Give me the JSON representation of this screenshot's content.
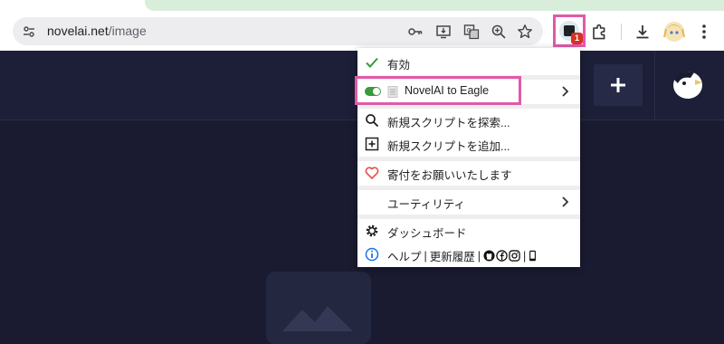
{
  "browser": {
    "url_host": "novelai.net",
    "url_path": "/image",
    "extension_badge": "1"
  },
  "menu": {
    "enabled_label": "有効",
    "script_name": "NovelAI to Eagle",
    "find_scripts_label": "新規スクリプトを探索...",
    "add_script_label": "新規スクリプトを追加...",
    "donate_label": "寄付をお願いいたします",
    "utilities_label": "ユーティリティ",
    "dashboard_label": "ダッシュボード",
    "help_label": "ヘルプ",
    "separator": "|",
    "changelog_label": "更新履歴"
  },
  "colors": {
    "highlight": "#e05aa8",
    "page_bg": "#1a1b31",
    "toggle_on": "#3a9a3a",
    "heart": "#e8534a"
  },
  "icons": [
    "site-info-icon",
    "key-icon",
    "install-app-icon",
    "translate-icon",
    "zoom-icon",
    "star-icon",
    "tampermonkey-icon",
    "puzzle-icon",
    "download-icon",
    "profile-avatar-icon",
    "kebab-menu-icon",
    "plus-icon",
    "novelai-logo",
    "check-icon",
    "script-file-icon",
    "search-icon",
    "add-box-icon",
    "heart-icon",
    "gear-icon",
    "info-icon",
    "github-icon",
    "facebook-icon",
    "instagram-icon",
    "phone-icon",
    "chevron-right-icon",
    "image-placeholder-icon"
  ]
}
